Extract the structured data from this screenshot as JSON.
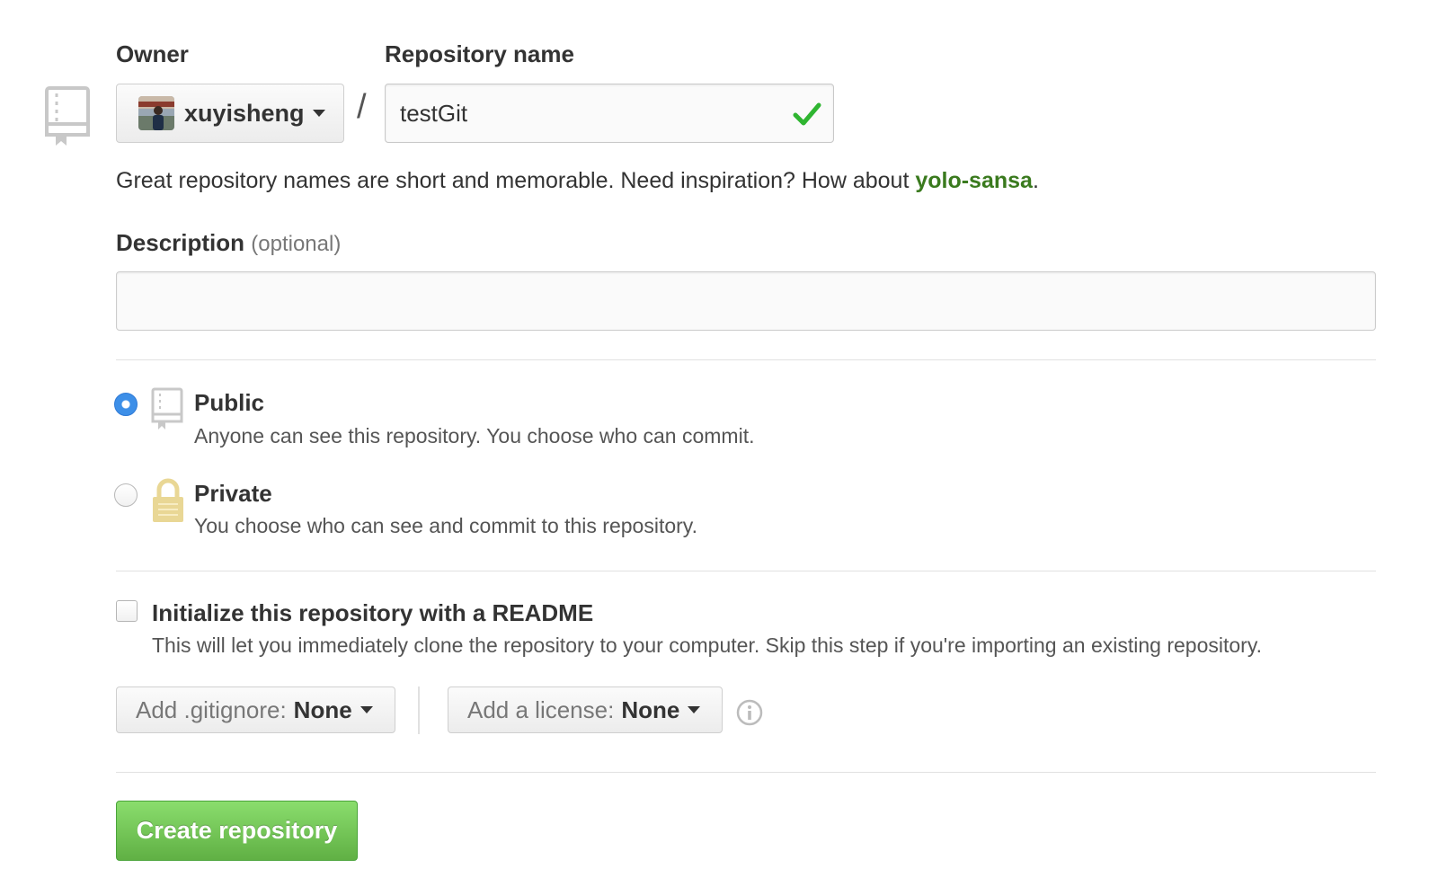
{
  "owner": {
    "label": "Owner",
    "selected": "xuyisheng"
  },
  "repository_name": {
    "label": "Repository name",
    "value": "testGit",
    "separator": "/"
  },
  "hint": {
    "text": "Great repository names are short and memorable. Need inspiration? How about ",
    "suggestion": "yolo-sansa",
    "suffix": "."
  },
  "description": {
    "label": "Description",
    "optional": "(optional)",
    "value": ""
  },
  "visibility": {
    "options": [
      {
        "title": "Public",
        "description": "Anyone can see this repository. You choose who can commit.",
        "checked": true,
        "icon": "repo-icon"
      },
      {
        "title": "Private",
        "description": "You choose who can see and commit to this repository.",
        "checked": false,
        "icon": "lock-icon"
      }
    ]
  },
  "readme": {
    "title": "Initialize this repository with a README",
    "description": "This will let you immediately clone the repository to your computer. Skip this step if you're importing an existing repository.",
    "checked": false
  },
  "gitignore": {
    "label": "Add .gitignore:",
    "value": "None"
  },
  "license": {
    "label": "Add a license:",
    "value": "None"
  },
  "create_button": {
    "label": "Create repository"
  },
  "colors": {
    "accent_green": "#60b044",
    "suggestion_green": "#3a7a1e",
    "radio_blue": "#3d8fe8",
    "lock_yellow": "#e9d795",
    "check_green": "#2fb531"
  }
}
